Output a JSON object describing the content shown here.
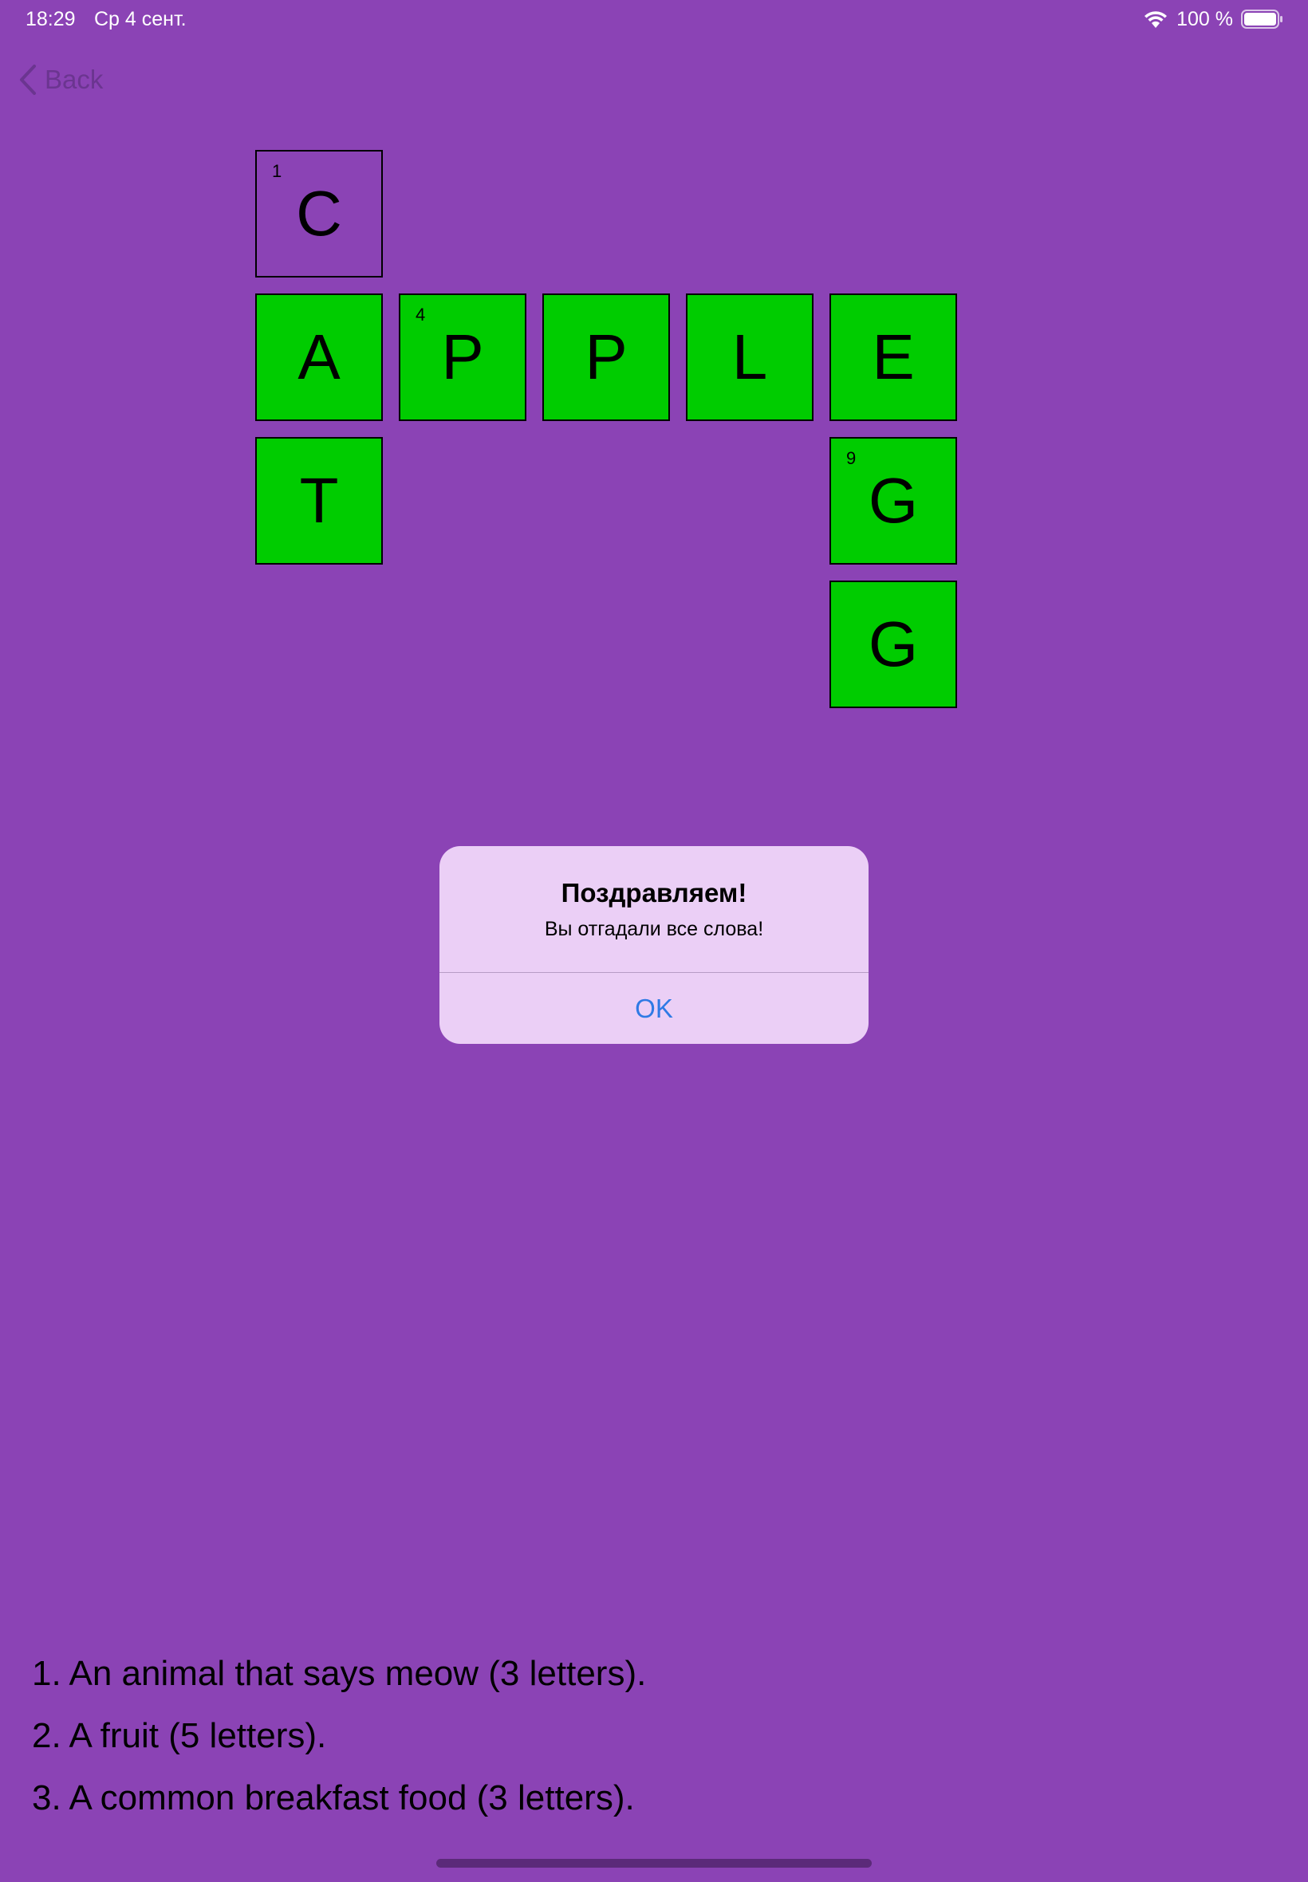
{
  "status_bar": {
    "time": "18:29",
    "date": "Ср 4 сент.",
    "battery_percent": "100 %",
    "icons": [
      "wifi-icon",
      "battery-icon"
    ]
  },
  "nav": {
    "back_label": "Back",
    "back_icon": "chevron-left-icon"
  },
  "crossword": {
    "filled_color": "#00cc00",
    "cells": [
      {
        "letter": "C",
        "number": "1",
        "filled": false
      },
      {
        "letter": "A",
        "number": "",
        "filled": true
      },
      {
        "letter": "P",
        "number": "4",
        "filled": true
      },
      {
        "letter": "P",
        "number": "",
        "filled": true
      },
      {
        "letter": "L",
        "number": "",
        "filled": true
      },
      {
        "letter": "E",
        "number": "",
        "filled": true
      },
      {
        "letter": "T",
        "number": "",
        "filled": true
      },
      {
        "letter": "G",
        "number": "9",
        "filled": true
      },
      {
        "letter": "G",
        "number": "",
        "filled": true
      }
    ]
  },
  "alert": {
    "title": "Поздравляем!",
    "message": "Вы отгадали все слова!",
    "ok_label": "OK"
  },
  "clues": [
    "1. An animal that says meow (3 letters).",
    "2. A fruit (5 letters).",
    "3. A common breakfast food (3 letters)."
  ],
  "colors": {
    "background": "#8b43b5",
    "alert_background": "#ebcff6",
    "alert_button": "#2f7ae5"
  }
}
